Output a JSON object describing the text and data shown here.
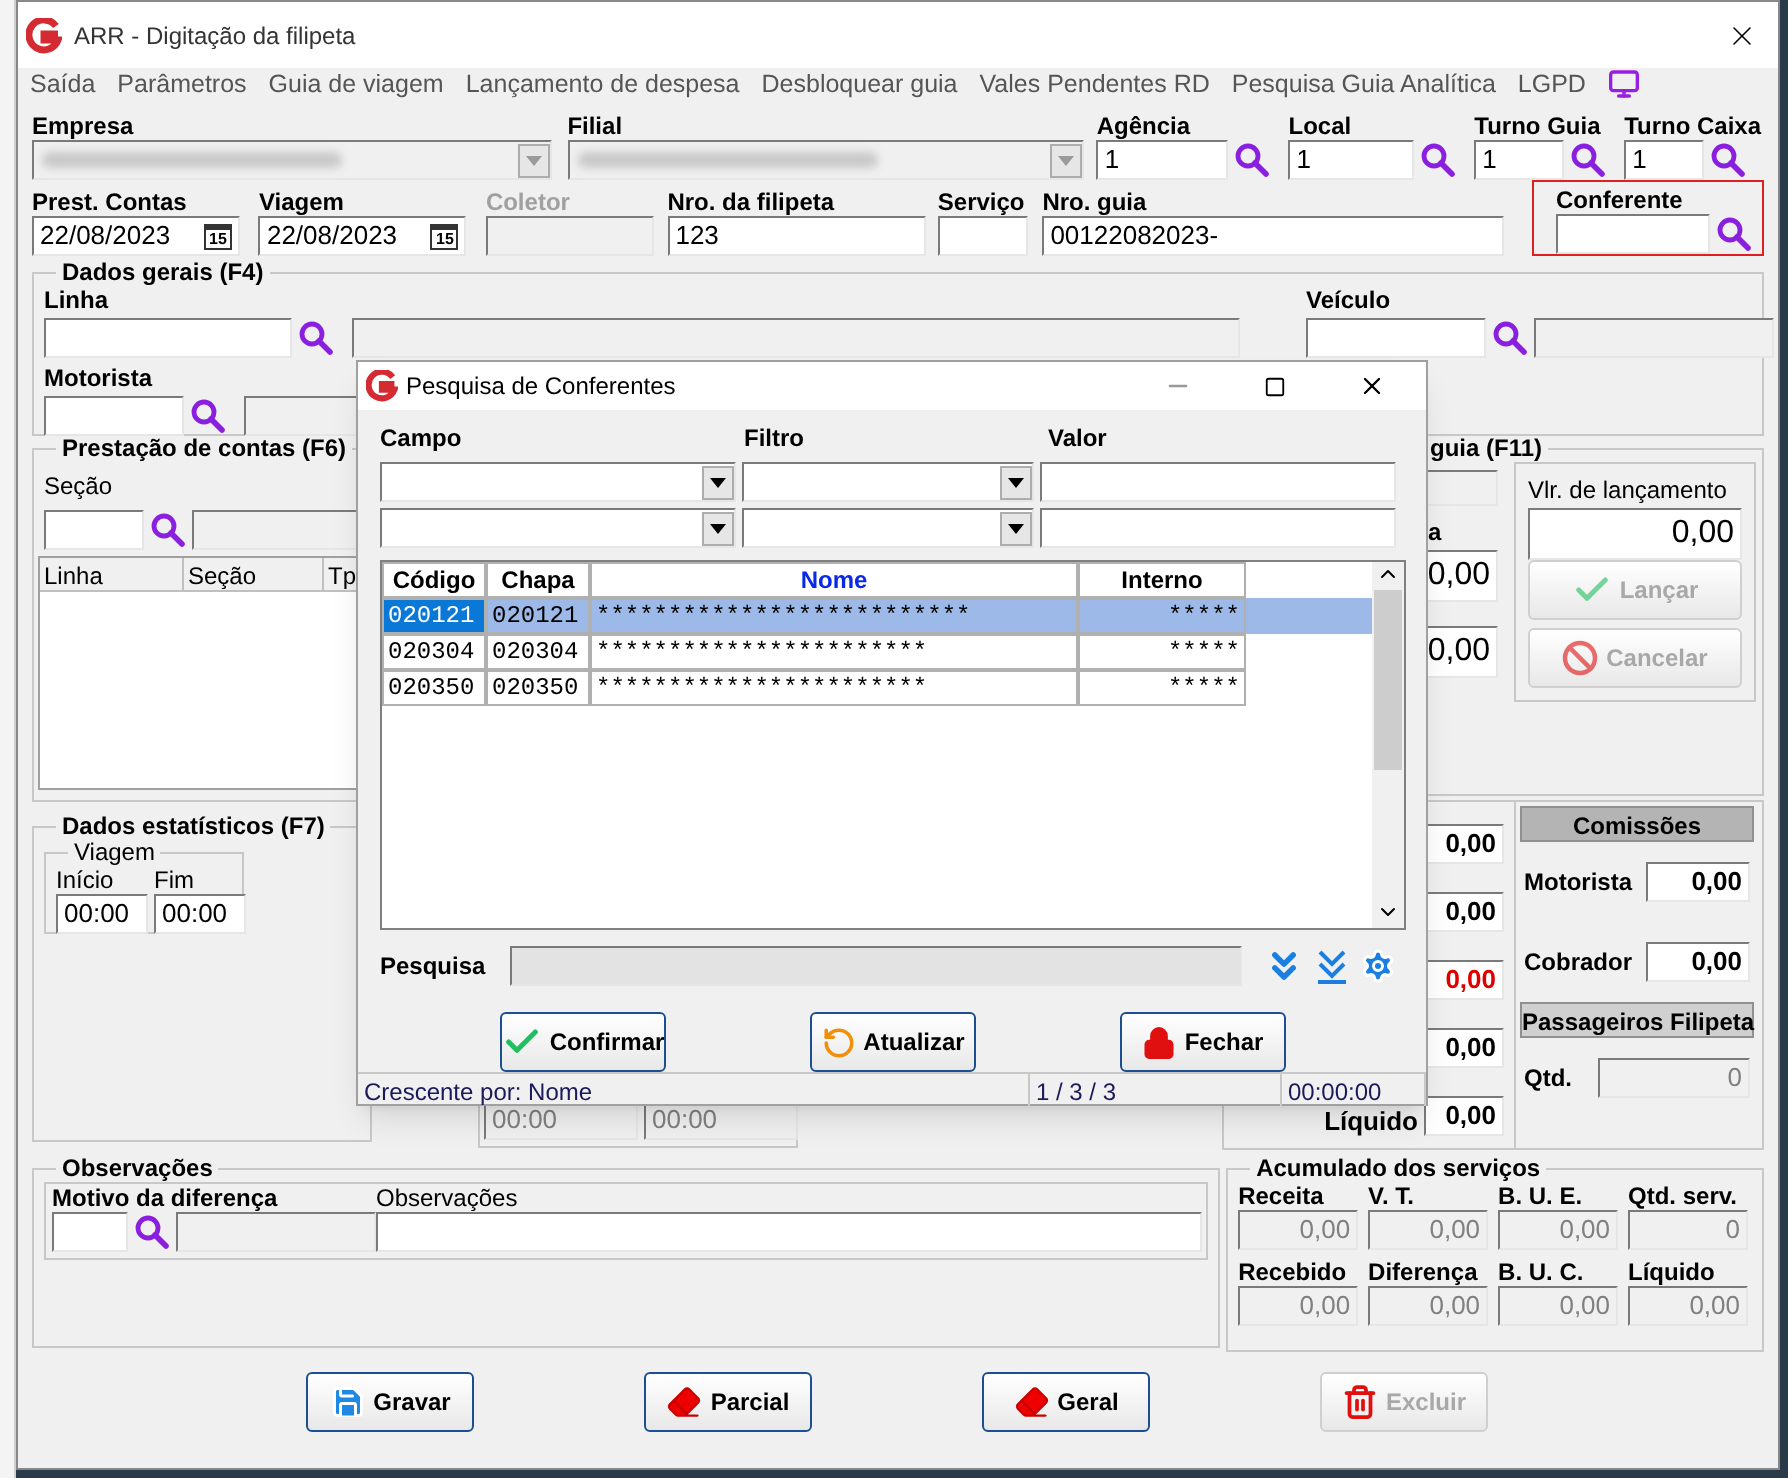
{
  "window": {
    "title": "ARR - Digitação da filipeta"
  },
  "menu": [
    "Saída",
    "Parâmetros",
    "Guia de viagem",
    "Lançamento de despesa",
    "Desbloquear guia",
    "Vales Pendentes RD",
    "Pesquisa Guia Analítica",
    "LGPD"
  ],
  "header": {
    "empresa": {
      "label": "Empresa"
    },
    "filial": {
      "label": "Filial"
    },
    "agencia": {
      "label": "Agência",
      "value": "1"
    },
    "local": {
      "label": "Local",
      "value": "1"
    },
    "turno_guia": {
      "label": "Turno Guia",
      "value": "1"
    },
    "turno_caixa": {
      "label": "Turno Caixa",
      "value": "1"
    },
    "prest_contas": {
      "label": "Prest. Contas",
      "value": "22/08/2023",
      "calendar": "15"
    },
    "viagem": {
      "label": "Viagem",
      "value": "22/08/2023",
      "calendar": "15"
    },
    "coletor": {
      "label": "Coletor",
      "disabled": true
    },
    "filipeta": {
      "label": "Nro. da filipeta",
      "value": "123"
    },
    "servico": {
      "label": "Serviço"
    },
    "guia": {
      "label": "Nro. guia",
      "value": "00122082023-"
    },
    "conferente": {
      "label": "Conferente",
      "highlighted": true
    }
  },
  "dados_gerais": {
    "title": "Dados gerais (F4)",
    "linha": {
      "label": "Linha"
    },
    "veiculo": {
      "label": "Veículo"
    },
    "motorista": {
      "label": "Motorista"
    }
  },
  "prestacao": {
    "title": "Prestação de contas (F6)",
    "secao": {
      "label": "Seção"
    },
    "columns": [
      "Linha",
      "Seção",
      "Tp"
    ]
  },
  "estatisticos": {
    "title": "Dados estatísticos (F7)",
    "viagem": {
      "title": "Viagem",
      "inicio": {
        "label": "Início",
        "value": "00:00"
      },
      "fim": {
        "label": "Fim",
        "value": "00:00"
      }
    },
    "times": [
      "00:00",
      "00:00"
    ]
  },
  "observacoes": {
    "title": "Observações",
    "motivo": {
      "label": "Motivo da diferença"
    },
    "obs": {
      "label": "Observações"
    }
  },
  "lancamento": {
    "title": "guia (F11)",
    "fragment": "a",
    "values": [
      "0,00",
      "0,00"
    ],
    "vlr": {
      "label": "Vlr. de lançamento",
      "value": "0,00"
    },
    "buttons": [
      {
        "label": "Lançar",
        "disabled": true
      },
      {
        "label": "Cancelar",
        "disabled": true
      }
    ]
  },
  "totais": {
    "values": [
      {
        "value": "0,00",
        "alert": false
      },
      {
        "value": "0,00",
        "alert": false
      },
      {
        "value": "0,00",
        "alert": true
      },
      {
        "value": "0,00",
        "alert": false
      }
    ],
    "liquido": {
      "label": "Líquido",
      "value": "0,00"
    }
  },
  "comissoes": {
    "title": "Comissões",
    "items": [
      {
        "label": "Motorista",
        "value": "0,00"
      },
      {
        "label": "Cobrador",
        "value": "0,00"
      }
    ]
  },
  "passageiros": {
    "title": "Passageiros Filipeta",
    "qtd": {
      "label": "Qtd.",
      "value": "0"
    }
  },
  "acumulado": {
    "title": "Acumulado dos serviços",
    "cells": [
      {
        "label": "Receita",
        "value": "0,00"
      },
      {
        "label": "V. T.",
        "value": "0,00"
      },
      {
        "label": "B. U. E.",
        "value": "0,00"
      },
      {
        "label": "Qtd. serv.",
        "value": "0"
      },
      {
        "label": "Recebido",
        "value": "0,00"
      },
      {
        "label": "Diferença",
        "value": "0,00"
      },
      {
        "label": "B. U. C.",
        "value": "0,00"
      },
      {
        "label": "Líquido",
        "value": "0,00"
      }
    ]
  },
  "actions": [
    {
      "label": "Gravar",
      "disabled": false
    },
    {
      "label": "Parcial",
      "disabled": false
    },
    {
      "label": "Geral",
      "disabled": false
    },
    {
      "label": "Excluir",
      "disabled": true
    }
  ],
  "dialog": {
    "title": "Pesquisa de Conferentes",
    "filter_labels": [
      "Campo",
      "Filtro",
      "Valor"
    ],
    "filter_rows": [
      {
        "kind": "combo"
      },
      {
        "kind": "combo"
      }
    ],
    "columns": [
      {
        "label": "Código",
        "sorted": false
      },
      {
        "label": "Chapa",
        "sorted": false
      },
      {
        "label": "Nome",
        "sorted": true
      },
      {
        "label": "Interno",
        "sorted": false
      }
    ],
    "rows": [
      {
        "cells": [
          "020121",
          "020121",
          "**************************",
          "*****"
        ],
        "selected": true
      },
      {
        "cells": [
          "020304",
          "020304",
          "***********************",
          "*****"
        ],
        "selected": false
      },
      {
        "cells": [
          "020350",
          "020350",
          "***********************",
          "*****"
        ],
        "selected": false
      }
    ],
    "search_label": "Pesquisa",
    "buttons": [
      {
        "label": "Confirmar"
      },
      {
        "label": "Atualizar"
      },
      {
        "label": "Fechar"
      }
    ],
    "status": [
      "Crescente por: Nome",
      "1 / 3 / 3",
      "00:00:00"
    ]
  }
}
